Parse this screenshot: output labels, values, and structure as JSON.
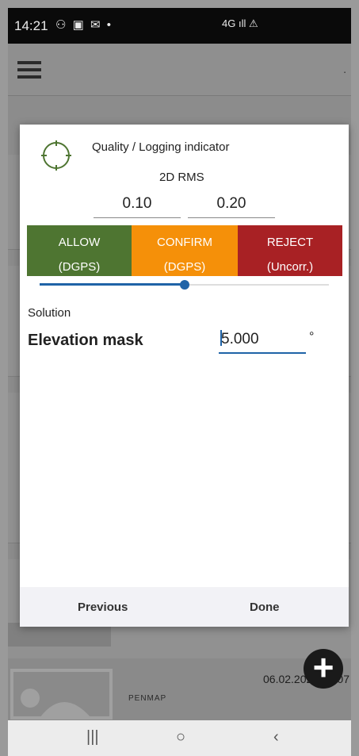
{
  "status_bar": {
    "time": "14:21",
    "notification_icons": "⚇ ▣ ✉ •",
    "signal": "4G ıll ⚠"
  },
  "app": {
    "more_dot": ".",
    "date": "06.02.2020 13.07",
    "brand": "PENMAP",
    "fab_label": "+"
  },
  "dialog": {
    "title": "Quality / Logging indicator",
    "subtitle": "2D RMS",
    "threshold_low": "0.10",
    "threshold_high": "0.20",
    "segments": [
      {
        "label": "ALLOW",
        "sub": "(DGPS)",
        "color": "#4e7531"
      },
      {
        "label": "CONFIRM",
        "sub": "(DGPS)",
        "color": "#f59009"
      },
      {
        "label": "REJECT",
        "sub": "(Uncorr.)",
        "color": "#a82124"
      }
    ],
    "slider_fraction": 0.5,
    "section": "Solution",
    "elevation_label": "Elevation mask",
    "elevation_value": "5.000",
    "elevation_unit": "°",
    "previous_label": "Previous",
    "done_label": "Done"
  },
  "nav": {
    "recents": "|||",
    "home": "○",
    "back": "‹"
  },
  "colors": {
    "accent": "#1f63a7",
    "target_icon": "#4e7531"
  }
}
